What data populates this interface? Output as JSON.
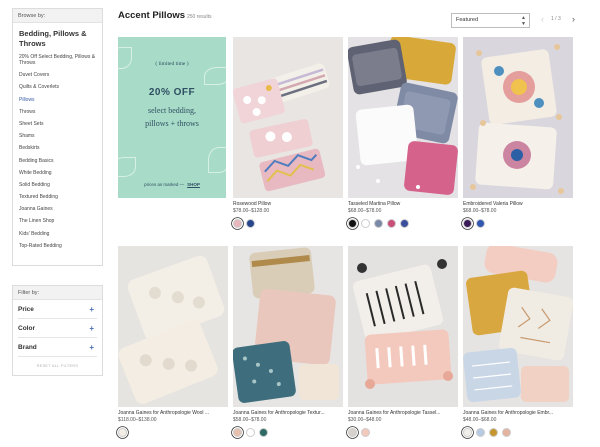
{
  "sidebar": {
    "browse_label": "Browse by:",
    "category_title": "Bedding, Pillows & Throws",
    "items": [
      {
        "label": "20% Off Select Bedding, Pillows & Throws"
      },
      {
        "label": "Duvet Covers"
      },
      {
        "label": "Quilts & Coverlets"
      },
      {
        "label": "Pillows"
      },
      {
        "label": "Throws"
      },
      {
        "label": "Sheet Sets"
      },
      {
        "label": "Shams"
      },
      {
        "label": "Bedskirts"
      },
      {
        "label": "Bedding Basics"
      },
      {
        "label": "White Bedding"
      },
      {
        "label": "Solid Bedding"
      },
      {
        "label": "Textured Bedding"
      },
      {
        "label": "Joanna Gaines"
      },
      {
        "label": "The Linen Shop"
      },
      {
        "label": "Kids' Bedding"
      },
      {
        "label": "Top-Rated Bedding"
      }
    ],
    "active_index": 3
  },
  "filters": {
    "label": "Filter by:",
    "items": [
      {
        "label": "Price",
        "icon": "plus-icon"
      },
      {
        "label": "Color",
        "icon": "plus-icon"
      },
      {
        "label": "Brand",
        "icon": "plus-icon"
      }
    ],
    "reset_label": "RESET ALL FILTERS"
  },
  "header": {
    "title": "Accent Pillows",
    "results": "250 results",
    "sort_selected": "Featured",
    "pager_text": "1 / 3"
  },
  "promo": {
    "limited": "( limited time )",
    "offer": "20% OFF",
    "line1": "select bedding,",
    "line2": "pillows + throws",
    "foot_text": "prices as marked —",
    "shop_label": "SHOP",
    "bg_color": "#a9dcc8"
  },
  "products": [
    {
      "name": "Rosewood Pillow",
      "price": "$78.00–$128.00",
      "swatches": [
        "#e7b7bd",
        "#27458c"
      ]
    },
    {
      "name": "Tasseled Martina Pillow",
      "price": "$68.00–$78.00",
      "swatches": [
        "#111111",
        "#ffffff",
        "#7a8aa6",
        "#c94e78",
        "#3a4e9c"
      ]
    },
    {
      "name": "Embroidered Valeria Pillow",
      "price": "$68.00–$78.00",
      "swatches": [
        "#3a1b57",
        "#3257b0"
      ]
    },
    {
      "name": "Joanna Gaines for Anthropologie Wool ...",
      "price": "$118.00–$138.00",
      "swatches": [
        "#f4efe6"
      ]
    },
    {
      "name": "Joanna Gaines for Anthropologie Textur...",
      "price": "$58.00–$78.00",
      "swatches": [
        "#e6c0ad",
        "#ffffff",
        "#2d6a64"
      ]
    },
    {
      "name": "Joanna Gaines for Anthropologie Tassel...",
      "price": "$30.00–$48.00",
      "swatches": [
        "#d6d2cb",
        "#f1c9bd"
      ]
    },
    {
      "name": "Joanna Gaines for Anthropologie Embr...",
      "price": "$48.00–$68.00",
      "swatches": [
        "#f1efe9",
        "#b7cae2",
        "#c6962e",
        "#e3b39f"
      ]
    }
  ]
}
